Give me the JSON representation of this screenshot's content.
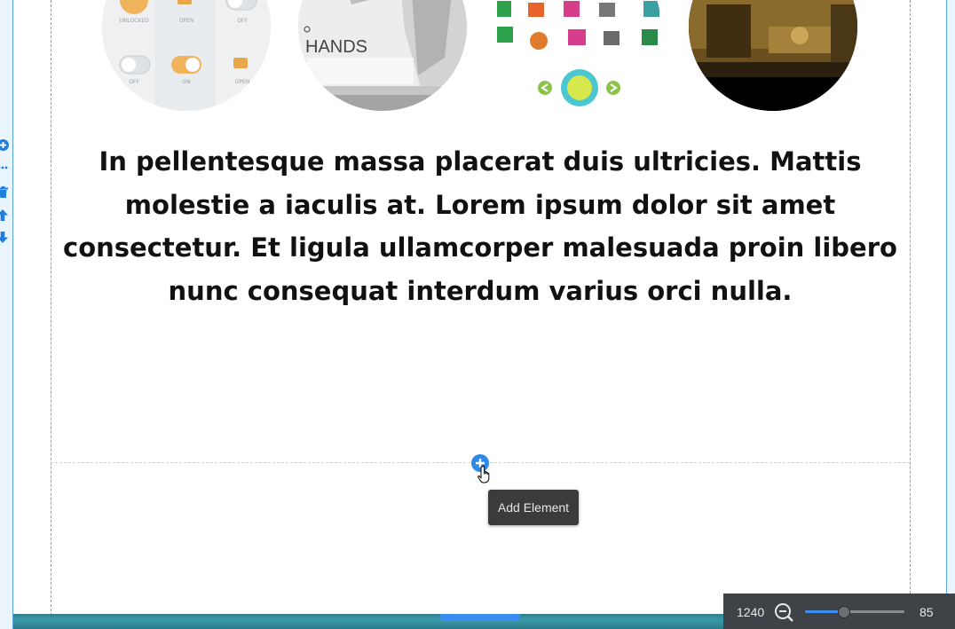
{
  "hero": {
    "text": "In pellentesque massa placerat duis ultricies. Mattis molestie a iaculis at. Lorem ipsum dolor sit amet consectetur. Et ligula ullamcorper malesuada proin libero nunc consequat interdum varius orci nulla."
  },
  "images": {
    "first_panel_labels": [
      "UNLOCKED",
      "OPEN",
      "OFF",
      "OFF",
      "ON",
      "OPEN"
    ],
    "second_caption": "HANDS"
  },
  "section_toolbar": {
    "icons": [
      "add-icon",
      "more-icon",
      "delete-icon",
      "move-up-icon",
      "move-down-icon"
    ]
  },
  "add_element": {
    "icon": "plus-icon",
    "tooltip": "Add Element"
  },
  "zoom": {
    "canvas_width": "1240",
    "zoom_out_icon": "zoom-out-icon",
    "level": "85",
    "slider_fraction": 0.38
  },
  "colors": {
    "accent": "#2f8ae6",
    "rail": "#5aa4e8",
    "toolbar_bg": "#3f4246"
  }
}
